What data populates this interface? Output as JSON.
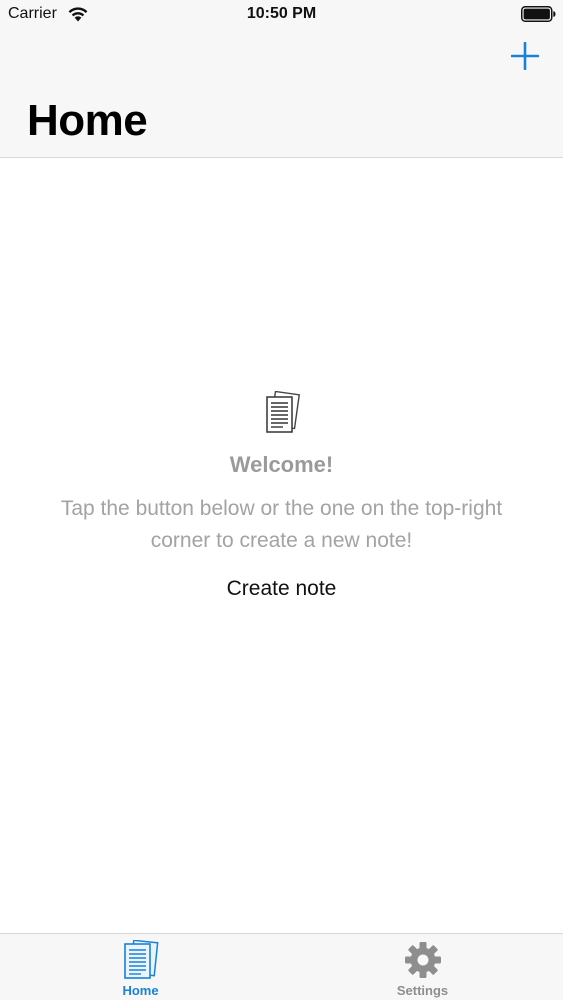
{
  "status_bar": {
    "carrier": "Carrier",
    "time": "10:50 PM",
    "wifi_icon": "wifi-icon",
    "battery_icon": "battery-icon"
  },
  "nav": {
    "title": "Home",
    "add_icon": "plus-icon",
    "accent_color": "#1a82d6"
  },
  "empty_state": {
    "icon": "document-icon",
    "heading": "Welcome!",
    "message": "Tap the button below or the one on the top-right corner to create a new note!",
    "action_label": "Create note"
  },
  "tabs": [
    {
      "label": "Home",
      "icon": "document-icon",
      "selected": true
    },
    {
      "label": "Settings",
      "icon": "gear-icon",
      "selected": false
    }
  ]
}
